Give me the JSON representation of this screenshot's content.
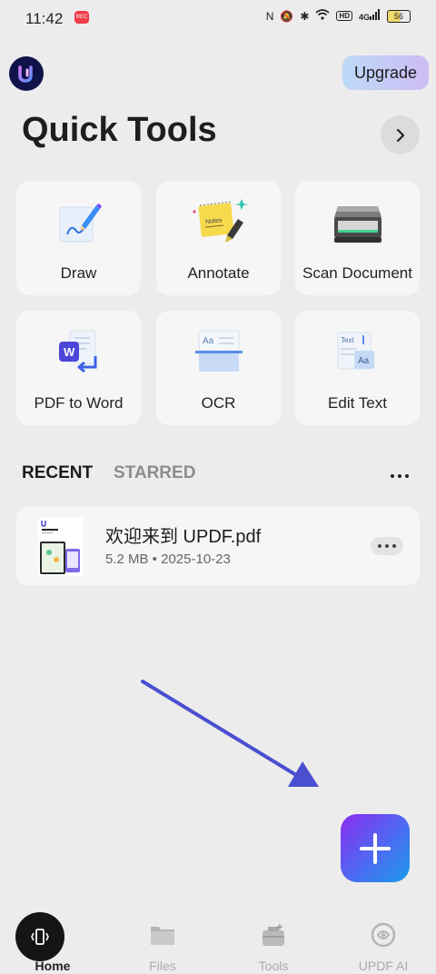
{
  "status_bar": {
    "time": "11:42",
    "recording_badge": "REC",
    "network_label": "4G",
    "hd_label": "HD",
    "battery": "56"
  },
  "header": {
    "logo_icon": "updf-logo-icon",
    "upgrade_label": "Upgrade"
  },
  "quick_tools": {
    "title": "Quick Tools",
    "tools": [
      {
        "label": "Draw",
        "icon": "draw-icon"
      },
      {
        "label": "Annotate",
        "icon": "annotate-icon"
      },
      {
        "label": "Scan Document",
        "icon": "scanner-icon"
      },
      {
        "label": "PDF to Word",
        "icon": "pdf-to-word-icon"
      },
      {
        "label": "OCR",
        "icon": "ocr-icon"
      },
      {
        "label": "Edit Text",
        "icon": "edit-text-icon"
      }
    ],
    "annotate_note": "Notes",
    "ocr_sample": "Aa",
    "edit_text_sample": "Text",
    "edit_text_sample2": "Aa",
    "word_letter": "W"
  },
  "tabs": {
    "recent": "RECENT",
    "starred": "STARRED"
  },
  "recent_files": [
    {
      "name": "欢迎来到 UPDF.pdf",
      "meta": "5.2 MB • 2025-10-23"
    }
  ],
  "bottom_nav": [
    {
      "label": "Home",
      "icon": "home-icon"
    },
    {
      "label": "Files",
      "icon": "folder-icon"
    },
    {
      "label": "Tools",
      "icon": "toolbox-icon"
    },
    {
      "label": "UPDF AI",
      "icon": "ai-icon"
    }
  ],
  "colors": {
    "accent": "#4c6bf2",
    "arrow": "#4a4fd0",
    "background": "#ececec"
  }
}
